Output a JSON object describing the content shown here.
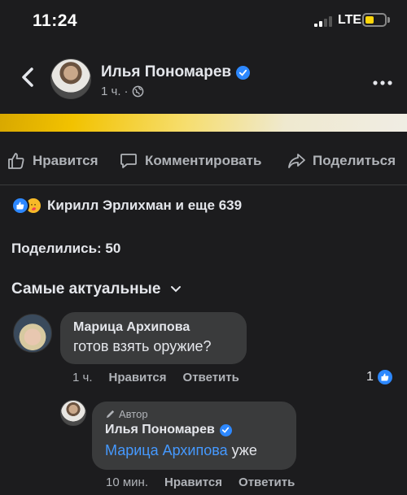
{
  "status_bar": {
    "time": "11:24",
    "network": "LTE",
    "battery_level": 0.45
  },
  "header": {
    "author_name": "Илья Пономарев",
    "post_time": "1 ч.",
    "back_icon": "chevron-left-icon",
    "more_icon": "more-dots-icon"
  },
  "actions": {
    "like": "Нравится",
    "comment": "Комментировать",
    "share": "Поделиться"
  },
  "reactions": {
    "summary": "Кирилл Эрлихман и еще 639"
  },
  "shares": {
    "text": "Поделились: 50"
  },
  "sort": {
    "label": "Самые актуальные"
  },
  "comments": [
    {
      "author": "Марица Архипова",
      "text": "готов взять оружие?",
      "time": "1 ч.",
      "like_label": "Нравится",
      "reply_label": "Ответить",
      "like_count": "1",
      "replies": [
        {
          "badge": "Автор",
          "author": "Илья Пономарев",
          "mention": "Марица Архипова",
          "text": "уже",
          "time": "10 мин.",
          "like_label": "Нравится",
          "reply_label": "Ответить"
        }
      ]
    }
  ],
  "colors": {
    "background": "#1c1c1e",
    "bubble": "#3a3b3c",
    "accent_blue": "#2d88ff",
    "banner_yellow": "#f2c200"
  }
}
